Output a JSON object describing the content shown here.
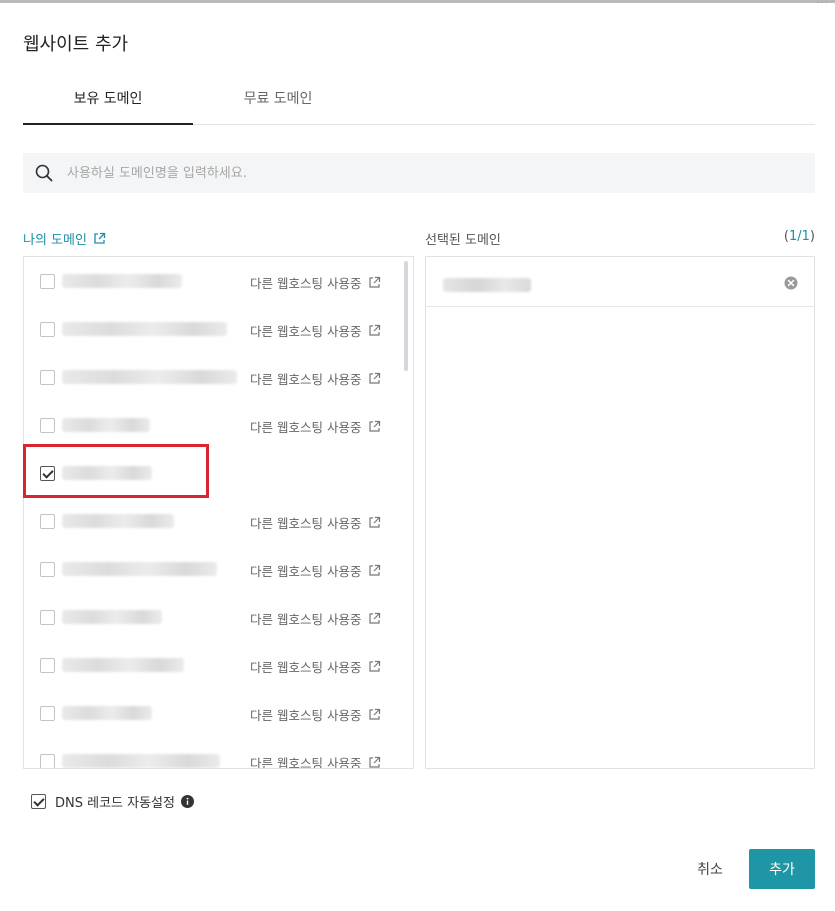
{
  "dialog": {
    "title": "웹사이트 추가"
  },
  "tabs": [
    {
      "label": "보유 도메인",
      "active": true
    },
    {
      "label": "무료 도메인",
      "active": false
    }
  ],
  "search": {
    "placeholder": "사용하실 도메인명을 입력하세요.",
    "value": "",
    "icon": "search-icon"
  },
  "my_domains": {
    "label": "나의 도메인",
    "icon": "external-link-icon",
    "rows": [
      {
        "checked": false,
        "status": "다른 웹호스팅 사용중"
      },
      {
        "checked": false,
        "status": "다른 웹호스팅 사용중"
      },
      {
        "checked": false,
        "status": "다른 웹호스팅 사용중"
      },
      {
        "checked": false,
        "status": "다른 웹호스팅 사용중"
      },
      {
        "checked": true,
        "status": ""
      },
      {
        "checked": false,
        "status": "다른 웹호스팅 사용중"
      },
      {
        "checked": false,
        "status": "다른 웹호스팅 사용중"
      },
      {
        "checked": false,
        "status": "다른 웹호스팅 사용중"
      },
      {
        "checked": false,
        "status": "다른 웹호스팅 사용중"
      },
      {
        "checked": false,
        "status": "다른 웹호스팅 사용중"
      },
      {
        "checked": false,
        "status": "다른 웹호스팅 사용중"
      }
    ]
  },
  "selected_domains": {
    "label": "선택된 도메인",
    "count_open": "(",
    "count_value": "1/1",
    "count_close": ")",
    "remove_icon": "close-circle-icon"
  },
  "dns": {
    "label": "DNS 레코드 자동설정",
    "checked": true,
    "icon": "info-icon"
  },
  "footer": {
    "cancel_label": "취소",
    "add_label": "추가"
  },
  "colors": {
    "accent": "#1f96a6",
    "link": "#1b8fa8",
    "highlight": "#d9252b"
  }
}
